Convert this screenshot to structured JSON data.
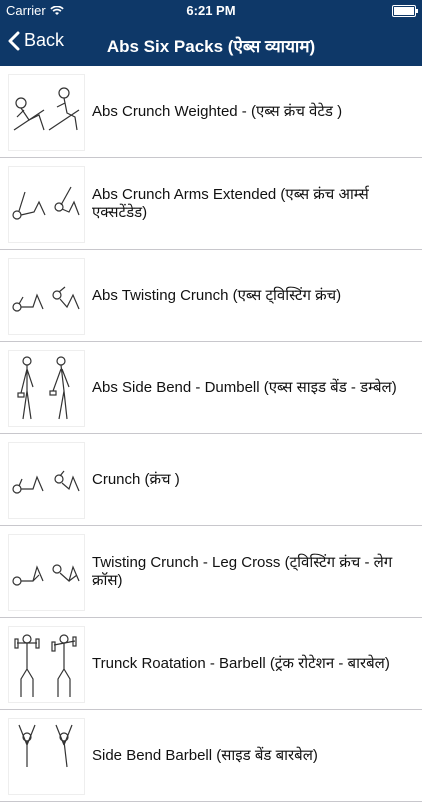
{
  "status": {
    "carrier": "Carrier",
    "time": "6:21 PM"
  },
  "nav": {
    "back_label": "Back",
    "title": "Abs Six Packs (ऐब्स व्यायाम)"
  },
  "exercises": [
    {
      "label": "Abs Crunch Weighted - (एब्स क्रंच वेटेड )",
      "icon": "crunch-weighted-icon"
    },
    {
      "label": "Abs Crunch Arms Extended (एब्स क्रंच आर्म्स एक्सटेंडेड)",
      "icon": "crunch-arms-extended-icon"
    },
    {
      "label": "Abs Twisting Crunch (एब्स ट्विस्टिंग क्रंच)",
      "icon": "twisting-crunch-icon"
    },
    {
      "label": "Abs Side Bend - Dumbell  (एब्स साइड बेंड - डम्बेल)",
      "icon": "side-bend-dumbell-icon"
    },
    {
      "label": "Crunch (क्रंच )",
      "icon": "crunch-icon"
    },
    {
      "label": "Twisting Crunch - Leg Cross (ट्विस्टिंग क्रंच - लेग क्रॉस)",
      "icon": "twisting-crunch-leg-cross-icon"
    },
    {
      "label": "Trunck Roatation - Barbell (ट्रंक रोटेशन - बारबेल)",
      "icon": "trunk-rotation-barbell-icon"
    },
    {
      "label": "Side Bend Barbell (साइड बेंड बारबेल)",
      "icon": "side-bend-barbell-icon"
    }
  ]
}
